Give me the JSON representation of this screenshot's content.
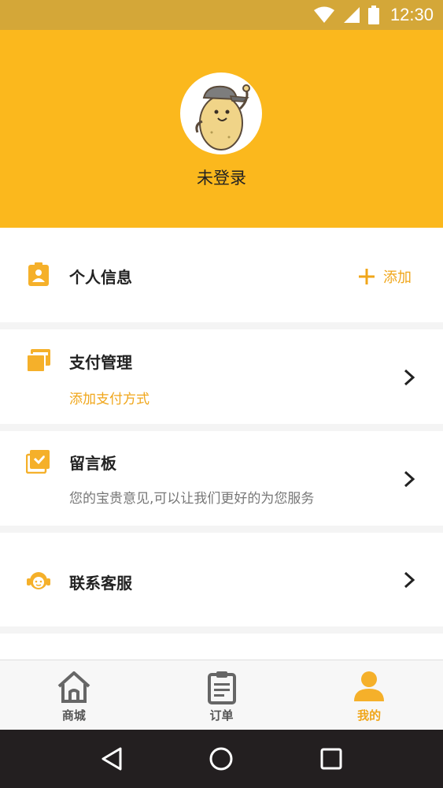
{
  "status_bar": {
    "time": "12:30"
  },
  "profile": {
    "username": "未登录"
  },
  "menu": {
    "personal_info": {
      "title": "个人信息",
      "action": "添加"
    },
    "payment": {
      "title": "支付管理",
      "subtitle": "添加支付方式"
    },
    "message_board": {
      "title": "留言板",
      "subtitle": "您的宝贵意见,可以让我们更好的为您服务"
    },
    "customer_service": {
      "title": "联系客服"
    }
  },
  "tabs": [
    {
      "label": "商城",
      "icon": "home-icon",
      "active": false
    },
    {
      "label": "订单",
      "icon": "order-icon",
      "active": false
    },
    {
      "label": "我的",
      "icon": "profile-icon",
      "active": true
    }
  ],
  "colors": {
    "accent": "#fbb81d",
    "accent_text": "#f0a61a",
    "status_bar": "#d4a738",
    "nav_bar": "#231f20"
  }
}
